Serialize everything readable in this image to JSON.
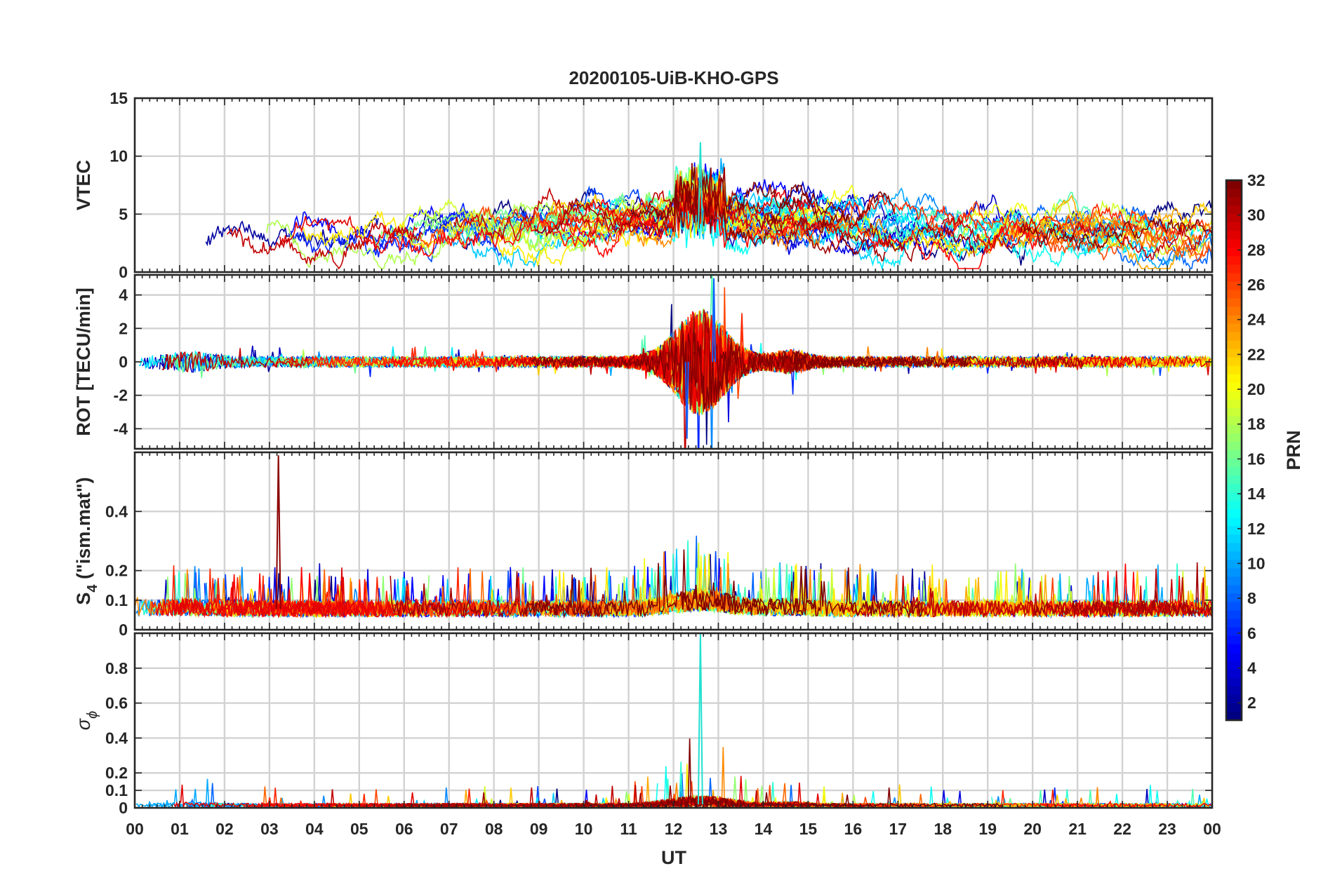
{
  "chart_data": {
    "type": "line",
    "title": "20200105-UiB-KHO-GPS",
    "xlabel": "UT",
    "x_ticks": [
      "00",
      "01",
      "02",
      "03",
      "04",
      "05",
      "06",
      "07",
      "08",
      "09",
      "10",
      "11",
      "12",
      "13",
      "14",
      "15",
      "16",
      "17",
      "18",
      "19",
      "20",
      "21",
      "22",
      "23",
      "00"
    ],
    "xlim_hours": [
      0,
      24
    ],
    "grid": true,
    "panels": [
      {
        "id": "vtec",
        "ylabel": "VTEC",
        "ylim": [
          0,
          15
        ],
        "yticks": [
          0,
          5,
          10,
          15
        ],
        "ytick_labels": [
          "0",
          "5",
          "10",
          "15"
        ],
        "baseline": 3.5,
        "typical_range": [
          1,
          9
        ],
        "peak": {
          "x": 12.6,
          "y": 11.2
        }
      },
      {
        "id": "rot",
        "ylabel": "ROT [TECU/min]",
        "ylim": [
          -5.2,
          5.2
        ],
        "yticks": [
          -4,
          -2,
          0,
          2,
          4
        ],
        "ytick_labels": [
          "-4",
          "-2",
          "0",
          "2",
          "4"
        ],
        "baseline": 0,
        "typical_range": [
          -1,
          1
        ],
        "extremes": [
          -4.6,
          5.0
        ]
      },
      {
        "id": "s4",
        "ylabel_main": "S",
        "ylabel_sub": "4",
        "ylabel_rest": " (\"ism.mat\")",
        "ylim": [
          0,
          0.6
        ],
        "yticks": [
          0,
          0.1,
          0.2,
          0.4
        ],
        "ytick_labels": [
          "0",
          "0.1",
          "0.2",
          "0.4"
        ],
        "baseline": 0.07,
        "typical_range": [
          0.03,
          0.15
        ],
        "peak": {
          "x": 3.2,
          "y": 0.59
        }
      },
      {
        "id": "sigma",
        "ylabel_main": "σ",
        "ylabel_sub": "ϕ",
        "ylim": [
          0,
          1.0
        ],
        "yticks": [
          0,
          0.1,
          0.2,
          0.4,
          0.6,
          0.8
        ],
        "ytick_labels": [
          "0",
          "0.1",
          "0.2",
          "0.4",
          "0.6",
          "0.8"
        ],
        "baseline": 0.02,
        "typical_range": [
          0,
          0.08
        ],
        "peak": {
          "x": 12.6,
          "y": 1.0
        }
      }
    ],
    "colorbar": {
      "label": "PRN",
      "range": [
        1,
        32
      ],
      "ticks": [
        2,
        4,
        6,
        8,
        10,
        12,
        14,
        16,
        18,
        20,
        22,
        24,
        26,
        28,
        30,
        32
      ],
      "colormap": "jet"
    }
  }
}
